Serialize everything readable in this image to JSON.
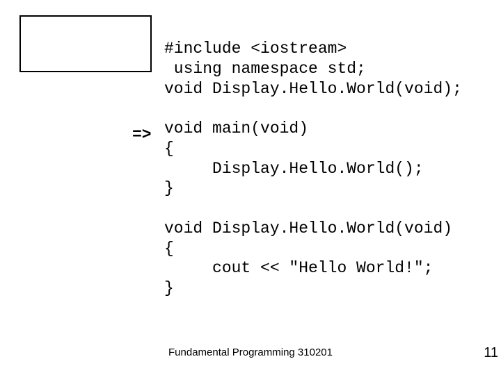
{
  "arrow": "=>",
  "code": {
    "line1": "#include <iostream>",
    "line2": " using namespace std;",
    "line3": "void Display.Hello.World(void);",
    "line4": "",
    "line5": "void main(void)",
    "line6": "{",
    "line7": "     Display.Hello.World();",
    "line8": "}",
    "line9": "",
    "line10": "void Display.Hello.World(void)",
    "line11": "{",
    "line12": "     cout << \"Hello World!\";",
    "line13": "}"
  },
  "footer": "Fundamental Programming 310201",
  "pagenum": "11"
}
